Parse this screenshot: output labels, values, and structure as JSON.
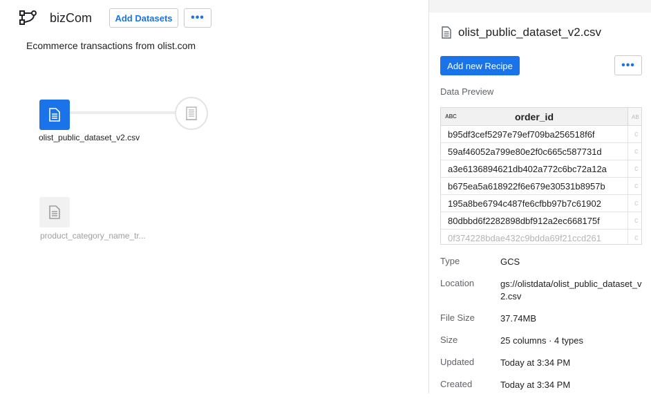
{
  "flow": {
    "name": "bizCom",
    "description": "Ecommerce transactions from olist.com",
    "add_datasets_label": "Add Datasets",
    "more_label": "•••",
    "nodes": [
      {
        "label": "olist_public_dataset_v2.csv",
        "icon": "file-document-icon",
        "state": "selected"
      },
      {
        "label": "product_category_name_tr...",
        "icon": "file-document-icon",
        "state": "inactive"
      }
    ],
    "recipe_icon": "recipe-icon"
  },
  "panel": {
    "title": "olist_public_dataset_v2.csv",
    "add_recipe_label": "Add new Recipe",
    "more_label": "•••",
    "preview_label": "Data Preview",
    "preview": {
      "type_badge": "ABC",
      "column": "order_id",
      "next_column_badge": "AB",
      "next_column_cell": "c",
      "rows": [
        "b95df3cef5297e79ef709ba256518f6f",
        "59af46052a799e80e2f0c665c587731d",
        "a3e6136894621db402a772c6bc72a12a",
        "b675ea5a618922f6e679e30531b8957b",
        "195a8be6794c487fe6cfbb97b7c61902",
        "80dbbd6f2282898dbf912a2ec668175f",
        "0f374228bdae432c9bdda69f21ccd261"
      ]
    },
    "details": [
      {
        "label": "Type",
        "value": "GCS"
      },
      {
        "label": "Location",
        "value": "gs://olistdata/olist_public_dataset_v2.csv"
      },
      {
        "label": "File Size",
        "value": "37.74MB"
      },
      {
        "label": "Size",
        "value": "25 columns · 4 types"
      },
      {
        "label": "Updated",
        "value": "Today at 3:34 PM"
      },
      {
        "label": "Created",
        "value": "Today at 3:34 PM"
      }
    ]
  },
  "colors": {
    "accent": "#1a73e8",
    "muted_text": "#5f6368"
  }
}
